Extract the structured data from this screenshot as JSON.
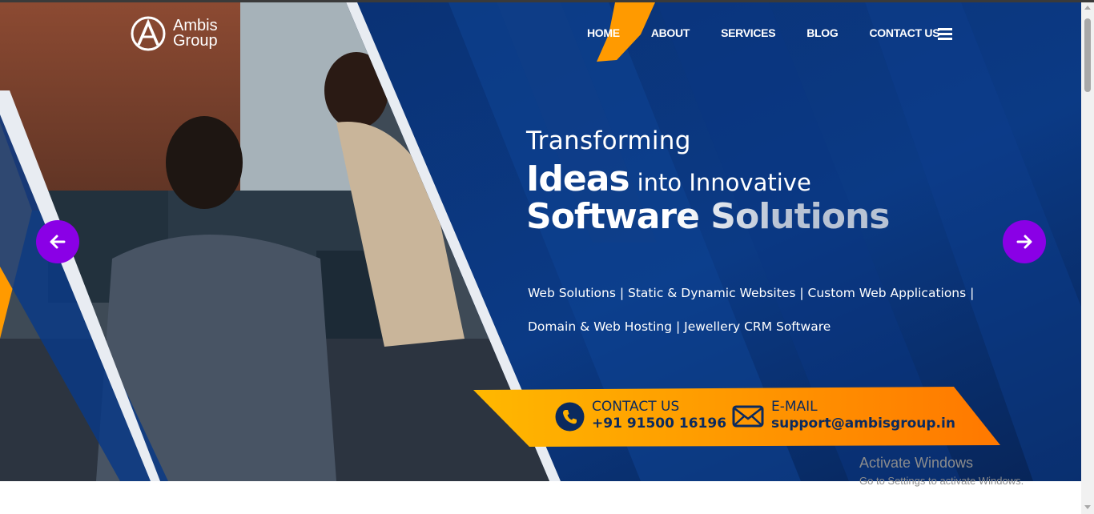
{
  "brand": {
    "line1": "Ambis",
    "line2": "Group"
  },
  "nav": {
    "items": [
      {
        "label": "HOME"
      },
      {
        "label": "ABOUT"
      },
      {
        "label": "SERVICES"
      },
      {
        "label": "BLOG"
      },
      {
        "label": "CONTACT US"
      }
    ]
  },
  "hero": {
    "line1": "Transforming",
    "line2_big": "Ideas",
    "line2_rest": "into Innovative",
    "line3": "Software Solutions",
    "services_line1": "Web Solutions | Static & Dynamic Websites | Custom Web Applications |",
    "services_line2": "Domain & Web Hosting | Jewellery CRM Software"
  },
  "contact": {
    "phone_label": "CONTACT US",
    "phone_value": "+91 91500 16196",
    "email_label": "E-MAIL",
    "email_value": "support@ambisgroup.in"
  },
  "watermark": {
    "title": "Activate Windows",
    "subtitle": "Go to Settings to activate Windows."
  },
  "colors": {
    "hero_blue": "#0b2f6e",
    "accent_orange": "#ff9a00",
    "arrow_purple": "#8a00e6"
  },
  "icons": {
    "prev": "arrow-left-icon",
    "next": "arrow-right-icon",
    "menu": "hamburger-icon",
    "phone": "phone-icon",
    "email": "envelope-icon"
  }
}
